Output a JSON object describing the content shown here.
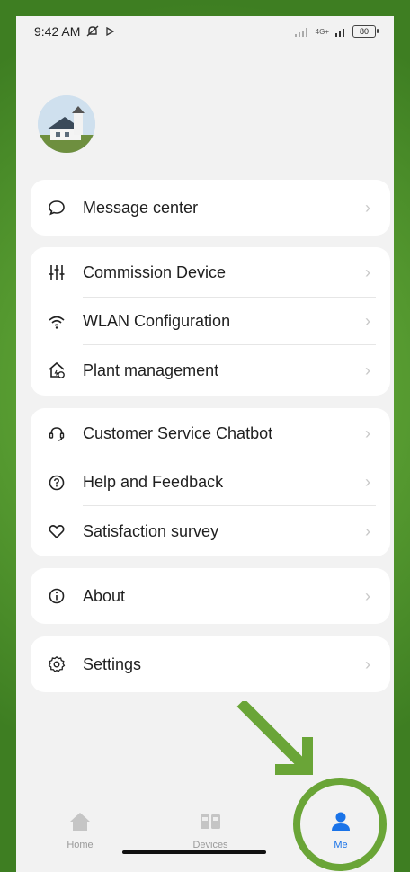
{
  "status": {
    "time": "9:42 AM",
    "network": "4G+",
    "battery": "80"
  },
  "menu": {
    "group1": [
      {
        "label": "Message center",
        "icon": "chat-bubble-icon"
      }
    ],
    "group2": [
      {
        "label": "Commission Device",
        "icon": "sliders-icon"
      },
      {
        "label": "WLAN Configuration",
        "icon": "wifi-icon"
      },
      {
        "label": "Plant management",
        "icon": "house-bolt-icon"
      }
    ],
    "group3": [
      {
        "label": "Customer Service Chatbot",
        "icon": "headset-icon"
      },
      {
        "label": "Help and Feedback",
        "icon": "help-circle-icon"
      },
      {
        "label": "Satisfaction survey",
        "icon": "heart-icon"
      }
    ],
    "group4": [
      {
        "label": "About",
        "icon": "info-icon"
      }
    ],
    "group5": [
      {
        "label": "Settings",
        "icon": "gear-icon"
      }
    ]
  },
  "nav": {
    "home": "Home",
    "devices": "Devices",
    "me": "Me",
    "active": "Me",
    "active_color": "#1a73e8"
  }
}
